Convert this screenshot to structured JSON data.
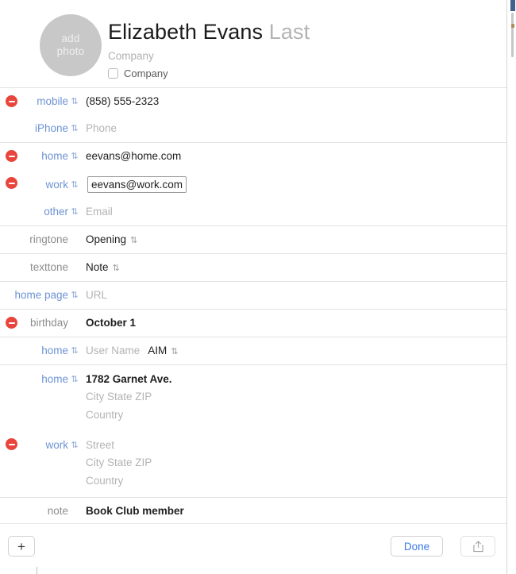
{
  "avatar": {
    "line1": "add",
    "line2": "photo"
  },
  "header": {
    "first_name": "Elizabeth",
    "last_name": "Evans",
    "last_placeholder": "Last",
    "company_placeholder": "Company",
    "company_checkbox_label": "Company"
  },
  "rows": [
    {
      "id": "phone-mobile",
      "label": "mobile",
      "label_style": "link",
      "deletable": true,
      "value": "(858) 555-2323",
      "is_placeholder": false,
      "section_start": true
    },
    {
      "id": "phone-iphone",
      "label": "iPhone",
      "label_style": "link",
      "deletable": false,
      "value": "Phone",
      "is_placeholder": true,
      "section_start": false
    },
    {
      "id": "email-home",
      "label": "home",
      "label_style": "link",
      "deletable": true,
      "value": "eevans@home.com",
      "is_placeholder": false,
      "section_start": true
    },
    {
      "id": "email-work",
      "label": "work",
      "label_style": "link",
      "deletable": true,
      "value": "eevans@work.com",
      "is_placeholder": false,
      "focused": true,
      "section_start": false
    },
    {
      "id": "email-other",
      "label": "other",
      "label_style": "link",
      "deletable": false,
      "value": "Email",
      "is_placeholder": true,
      "section_start": false
    },
    {
      "id": "ringtone",
      "label": "ringtone",
      "label_style": "plain",
      "deletable": false,
      "no_stepper": true,
      "value": "Opening",
      "is_placeholder": false,
      "trailing_stepper": true,
      "section_start": true
    },
    {
      "id": "texttone",
      "label": "texttone",
      "label_style": "plain",
      "deletable": false,
      "no_stepper": true,
      "value": "Note",
      "is_placeholder": false,
      "trailing_stepper": true,
      "section_start": true
    },
    {
      "id": "home-page",
      "label": "home page",
      "label_style": "link",
      "deletable": false,
      "value": "URL",
      "is_placeholder": true,
      "section_start": true
    },
    {
      "id": "birthday",
      "label": "birthday",
      "label_style": "plain",
      "deletable": true,
      "no_stepper": true,
      "value": "October 1",
      "is_placeholder": false,
      "bold": true,
      "section_start": true
    },
    {
      "id": "im-home",
      "label": "home",
      "label_style": "link",
      "deletable": false,
      "value": "User Name",
      "is_placeholder": true,
      "service": "AIM",
      "section_start": true
    }
  ],
  "addresses": [
    {
      "id": "address-home",
      "label": "home",
      "deletable": false,
      "street": "1782 Garnet Ave.",
      "street_is_placeholder": false,
      "citystatezip": "City State ZIP",
      "country": "Country"
    },
    {
      "id": "address-work",
      "label": "work",
      "deletable": true,
      "street": "Street",
      "street_is_placeholder": true,
      "citystatezip": "City State ZIP",
      "country": "Country"
    }
  ],
  "note": {
    "label": "note",
    "value": "Book Club member"
  },
  "footer": {
    "add_label": "+",
    "done_label": "Done"
  },
  "colors": {
    "link": "#6d93d4",
    "delete": "#e8453c",
    "done": "#3b78e7",
    "placeholder": "#b3b3b3"
  }
}
